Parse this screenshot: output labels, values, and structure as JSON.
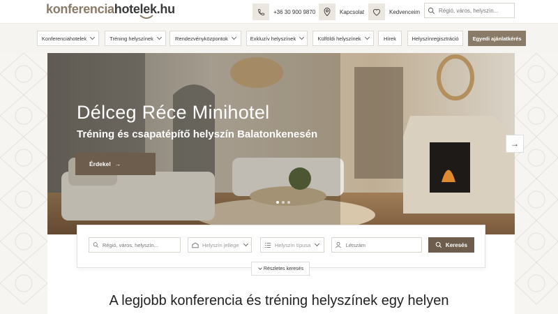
{
  "logo": {
    "part1": "konferencia",
    "part2": "hotelek.hu"
  },
  "topbar": {
    "phone": "+36 30 900 9870",
    "contact": "Kapcsolat",
    "favorites": "Kedvenceim",
    "search_placeholder": "Régió, város, helyszín..."
  },
  "nav": {
    "items": [
      {
        "label": "Konferenciahotelek",
        "dropdown": true
      },
      {
        "label": "Tréning helyszínek",
        "dropdown": true
      },
      {
        "label": "Rendezvényközpontok",
        "dropdown": true
      },
      {
        "label": "Exkluzív helyszínek",
        "dropdown": true
      },
      {
        "label": "Külföldi helyszínek",
        "dropdown": true
      },
      {
        "label": "Hírek",
        "dropdown": false
      },
      {
        "label": "Helyszínregisztráció",
        "dropdown": false
      },
      {
        "label": "Egyedi ajánlatkérés",
        "dropdown": false
      }
    ]
  },
  "hero": {
    "title": "Délceg Réce Minihotel",
    "subtitle": "Tréning és csapatépítő helyszín Balatonkenesén",
    "button": "Érdekel"
  },
  "search": {
    "location_placeholder": "Régió, város, helyszín...",
    "character_label": "Helyszín jellege",
    "type_label": "Helyszín típusa",
    "headcount_placeholder": "Létszám",
    "submit": "Keresés",
    "advanced": "Részletes keresés"
  },
  "headline": "A legjobb konferencia és tréning helyszínek egy helyen",
  "colors": {
    "accent": "#8a7b68",
    "dark_accent": "#6c5d4c",
    "nav_bg": "#f6f4f1"
  }
}
